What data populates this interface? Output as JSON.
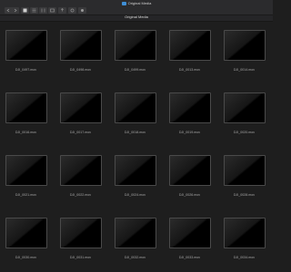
{
  "window": {
    "title": "Original Media"
  },
  "location": {
    "label": "Original Media"
  },
  "toolbar": {
    "buttons": [
      {
        "name": "back-forward-button",
        "icon": "chevron-left-icon"
      },
      {
        "name": "view-icons-button",
        "icon": "grid-icon"
      },
      {
        "name": "view-list-button",
        "icon": "list-icon"
      },
      {
        "name": "view-columns-button",
        "icon": "columns-icon"
      },
      {
        "name": "arrange-button",
        "icon": "arrange-icon"
      },
      {
        "name": "share-button",
        "icon": "share-icon"
      },
      {
        "name": "tags-button",
        "icon": "tag-icon"
      },
      {
        "name": "actions-button",
        "icon": "gear-icon"
      }
    ]
  },
  "files": [
    "DJI_0497.mov",
    "DJI_0498.mov",
    "DJI_0499.mov",
    "DJI_0013.mov",
    "DJI_0014.mov",
    "DJI_0016.mov",
    "DJI_0017.mov",
    "DJI_0018.mov",
    "DJI_0019.mov",
    "DJI_0020.mov",
    "DJI_0021.mov",
    "DJI_0022.mov",
    "DJI_0024.mov",
    "DJI_0026.mov",
    "DJI_0028.mov",
    "DJI_0030.mov",
    "DJI_0031.mov",
    "DJI_0032.mov",
    "DJI_0033.mov",
    "DJI_0034.mov"
  ]
}
